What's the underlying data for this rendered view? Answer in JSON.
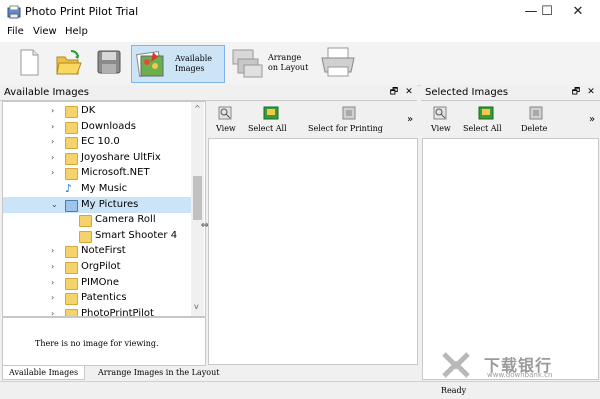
{
  "window": {
    "title": "Photo Print Pilot Trial",
    "minimize": "—",
    "maximize": "☐",
    "close": "✕"
  },
  "menu": [
    "File",
    "View",
    "Help"
  ],
  "toolbar": {
    "available_line1": "Available",
    "available_line2": "Images",
    "arrange_line1": "Arrange",
    "arrange_line2": "on Layout"
  },
  "left_panel": {
    "title": "Available Images",
    "tree": [
      {
        "label": "DK",
        "type": "folder",
        "expand": "›"
      },
      {
        "label": "Downloads",
        "type": "folder",
        "expand": "›"
      },
      {
        "label": "EC 10.0",
        "type": "folder",
        "expand": "›"
      },
      {
        "label": "Joyoshare UltFix",
        "type": "folder",
        "expand": "›"
      },
      {
        "label": "Microsoft.NET",
        "type": "folder",
        "expand": "›"
      },
      {
        "label": "My Music",
        "type": "music",
        "expand": ""
      },
      {
        "label": "My Pictures",
        "type": "pictures",
        "expand": "⌄"
      },
      {
        "label": "Camera Roll",
        "type": "folder",
        "expand": ""
      },
      {
        "label": "Smart Shooter 4",
        "type": "folder",
        "expand": ""
      },
      {
        "label": "NoteFirst",
        "type": "folder",
        "expand": "›"
      },
      {
        "label": "OrgPilot",
        "type": "folder",
        "expand": "›"
      },
      {
        "label": "PIMOne",
        "type": "folder",
        "expand": "›"
      },
      {
        "label": "Patentics",
        "type": "folder",
        "expand": "›"
      },
      {
        "label": "PhotoPrintPilot",
        "type": "folder",
        "expand": "›"
      }
    ],
    "no_image_text": "There is no image for viewing."
  },
  "middle_panel": {
    "view": "View",
    "select_all": "Select All",
    "select_for_printing": "Select for Printing",
    "more": "»"
  },
  "right_panel": {
    "title": "Selected Images",
    "view": "View",
    "select_all": "Select All",
    "delete": "Delete",
    "more": "»"
  },
  "panel_buttons": {
    "restore": "🗗",
    "close": "✕"
  },
  "tabs": [
    "Available Images",
    "Arrange Images in the Layout"
  ],
  "status": {
    "text": "Ready"
  },
  "watermark": {
    "text": "下载银行",
    "url": "www.downbank.cn"
  },
  "colors": {
    "selected": "#cce4f7",
    "active_button": "#cde4f7",
    "folder": "#f5d26b"
  }
}
